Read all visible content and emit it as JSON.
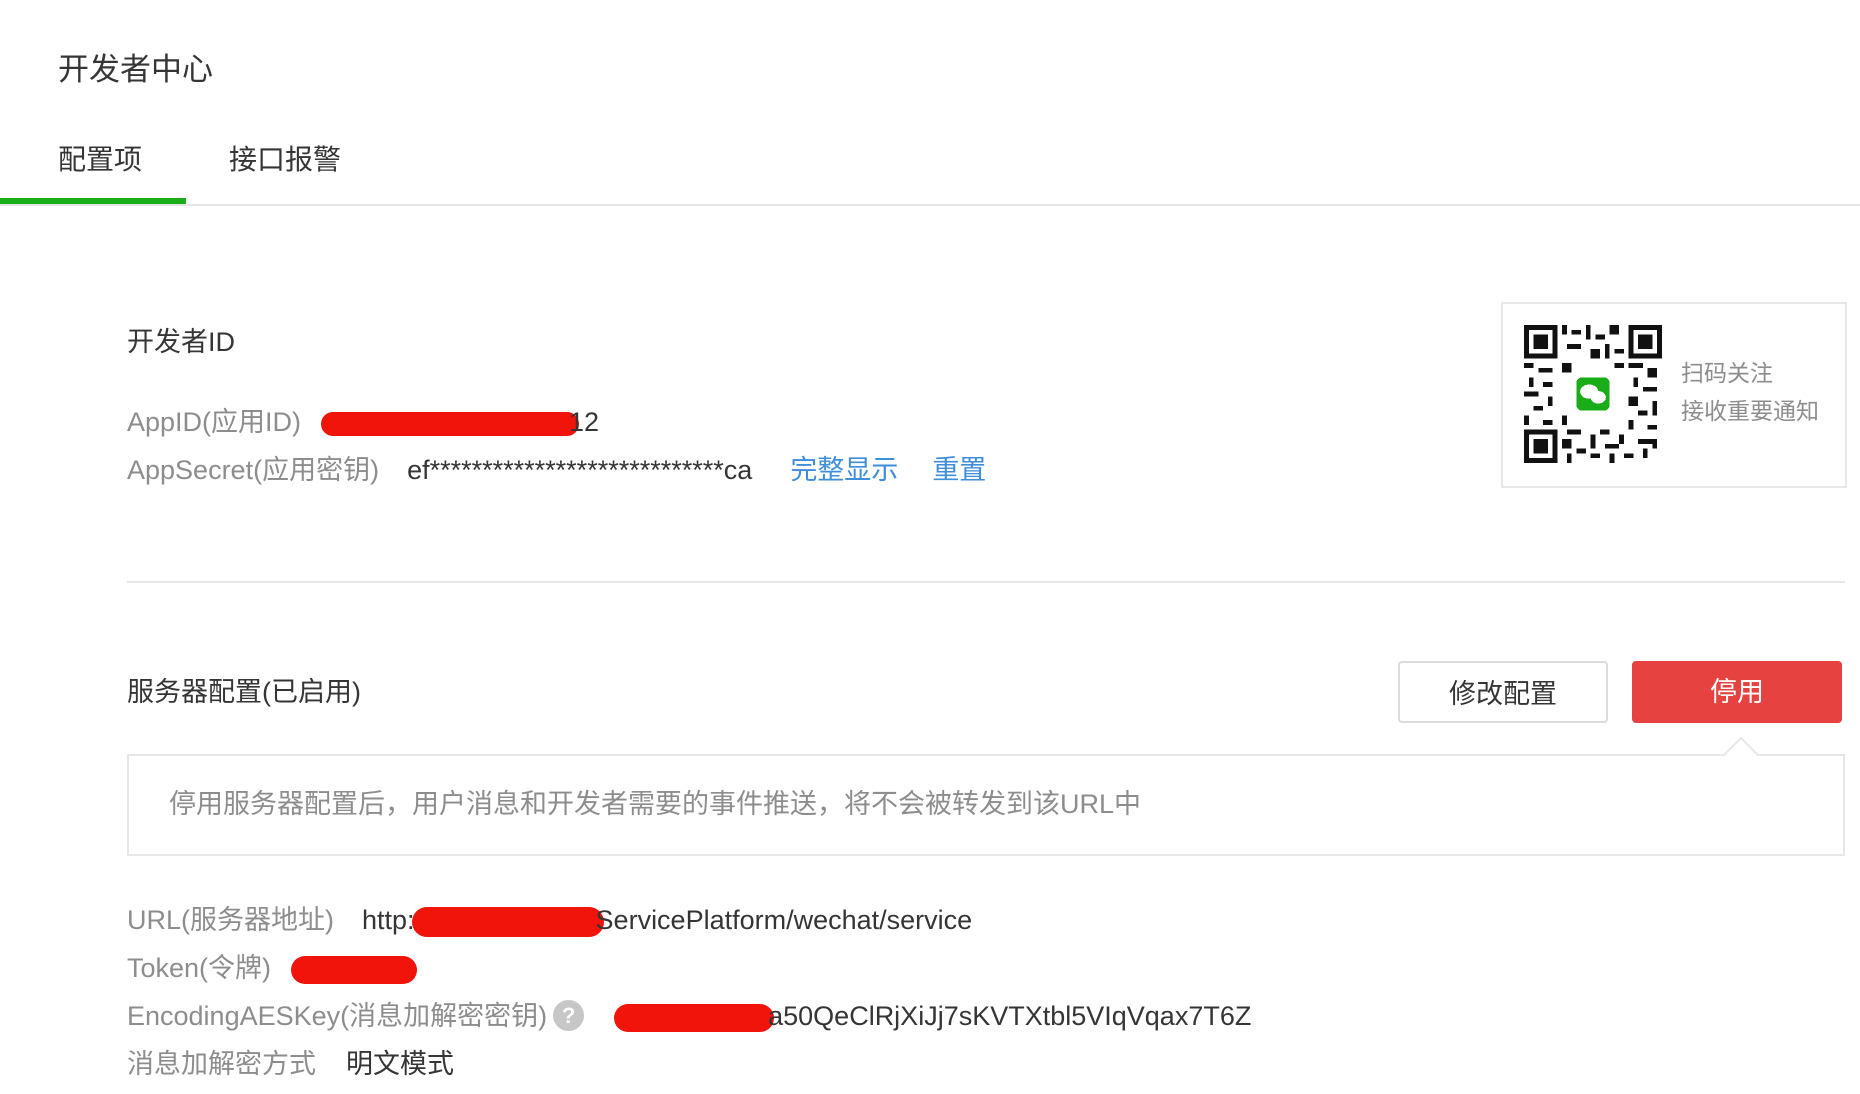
{
  "page": {
    "title": "开发者中心"
  },
  "tabs": [
    {
      "label": "配置项",
      "active": true
    },
    {
      "label": "接口报警",
      "active": false
    }
  ],
  "developer_id": {
    "section_title": "开发者ID",
    "appid_label": "AppID(应用ID)",
    "appid_value_visible": "12",
    "appsecret_label": "AppSecret(应用密钥)",
    "appsecret_value": "ef****************************ca",
    "show_full_link": "完整显示",
    "reset_link": "重置"
  },
  "qr_card": {
    "line1": "扫码关注",
    "line2": "接收重要通知"
  },
  "server_config": {
    "section_title": "服务器配置(已启用)",
    "edit_button": "修改配置",
    "disable_button": "停用",
    "tip": "停用服务器配置后，用户消息和开发者需要的事件推送，将不会被转发到该URL中",
    "url_label": "URL(服务器地址)",
    "url_prefix": "http://",
    "url_suffix": "ServicePlatform/wechat/service",
    "token_label": "Token(令牌)",
    "aes_label": "EncodingAESKey(消息加解密密钥)",
    "aes_help": "?",
    "aes_value_visible": "a50QeClRjXiJj7sKVTXtbl5VIqVqax7T6Z",
    "mode_label": "消息加解密方式",
    "mode_value": "明文模式"
  },
  "colors": {
    "accent_green": "#1aad19",
    "danger_red": "#e64340",
    "link_blue": "#3e8ed9",
    "redaction": "#f0140a"
  }
}
